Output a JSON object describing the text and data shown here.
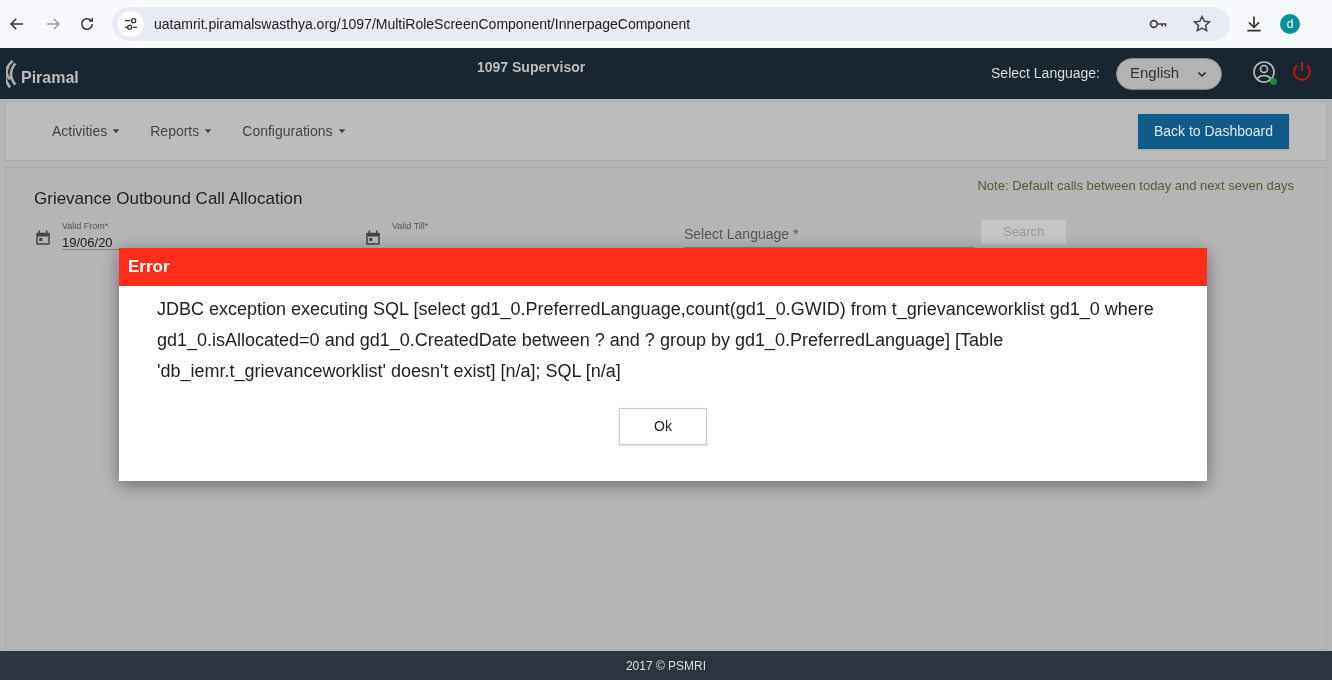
{
  "browser": {
    "url": "uatamrit.piramalswasthya.org/1097/MultiRoleScreenComponent/InnerpageComponent",
    "profile_initial": "d"
  },
  "header": {
    "logo": "Piramal",
    "title": "1097 Supervisor",
    "language_label": "Select Language:",
    "language_value": "English"
  },
  "nav": {
    "menus": [
      "Activities",
      "Reports",
      "Configurations"
    ],
    "back_button": "Back to Dashboard"
  },
  "page": {
    "title": "Grievance Outbound Call Allocation",
    "note": "Note: Default calls between today and next seven days",
    "fields": [
      {
        "label": "Valid From*",
        "value": "19/06/20"
      },
      {
        "label": "Valid Till*"
      }
    ],
    "select_label": "Select Language *",
    "search_button": "Search"
  },
  "dialog": {
    "title": "Error",
    "message": "JDBC exception executing SQL [select gd1_0.PreferredLanguage,count(gd1_0.GWID) from t_grievanceworklist gd1_0 where gd1_0.isAllocated=0 and gd1_0.CreatedDate between ? and ? group by gd1_0.PreferredLanguage] [Table 'db_iemr.t_grievanceworklist' doesn't exist] [n/a]; SQL [n/a]",
    "ok_button": "Ok"
  },
  "footer": "2017 © PSMRI"
}
